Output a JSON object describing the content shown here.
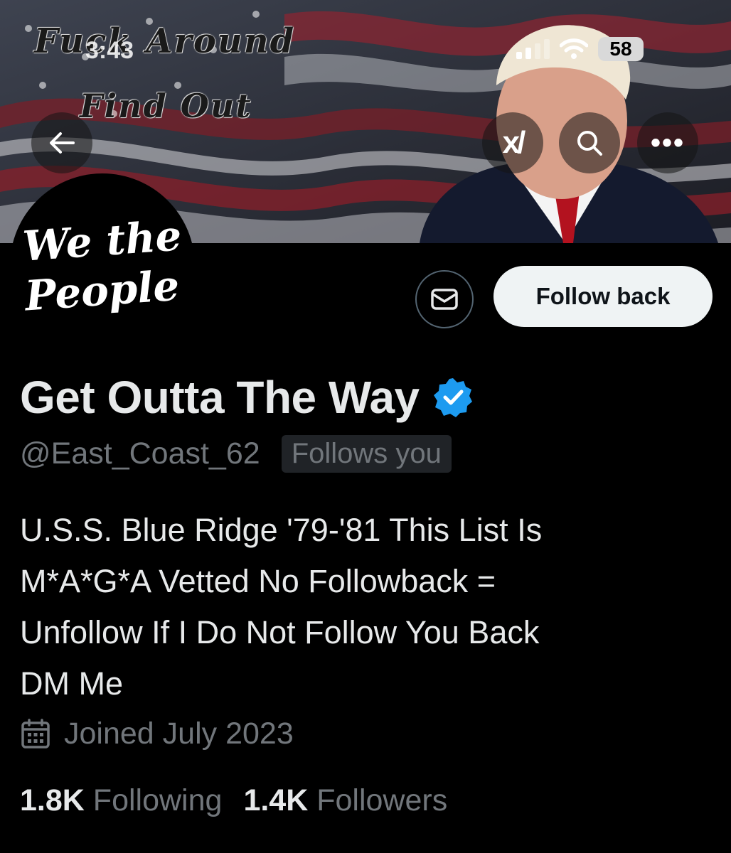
{
  "banner": {
    "line1": "Fuck Around",
    "line2": "Find Out"
  },
  "status_bar": {
    "time": "3:43",
    "battery": "58"
  },
  "header": {
    "back_icon": "arrow-left-icon",
    "grok_icon": "xai-grok-icon",
    "xai_label": "x/",
    "search_icon": "search-icon",
    "more_icon": "more-icon",
    "more_label": "•••"
  },
  "avatar": {
    "text_line1": "We the",
    "text_line2": "People"
  },
  "actions": {
    "message_icon": "envelope-icon",
    "follow_back_label": "Follow back"
  },
  "profile": {
    "display_name": "Get Outta The Way",
    "verified_icon": "verified-badge-icon",
    "handle": "@East_Coast_62",
    "follows_you": "Follows you",
    "bio_lines": [
      "U.S.S. Blue Ridge '79-'81 This List Is",
      "M*A*G*A Vetted No Followback =",
      "Unfollow If I Do Not Follow You Back",
      "DM Me"
    ],
    "calendar_icon": "calendar-icon",
    "joined": "Joined July 2023",
    "following_count": "1.8K",
    "following_label": "Following",
    "followers_count": "1.4K",
    "followers_label": "Followers"
  },
  "colors": {
    "background": "#000000",
    "text_primary": "#e7e9ea",
    "text_secondary": "#71767b",
    "verified_blue": "#1d9bf0",
    "button_light": "#eff3f4"
  }
}
